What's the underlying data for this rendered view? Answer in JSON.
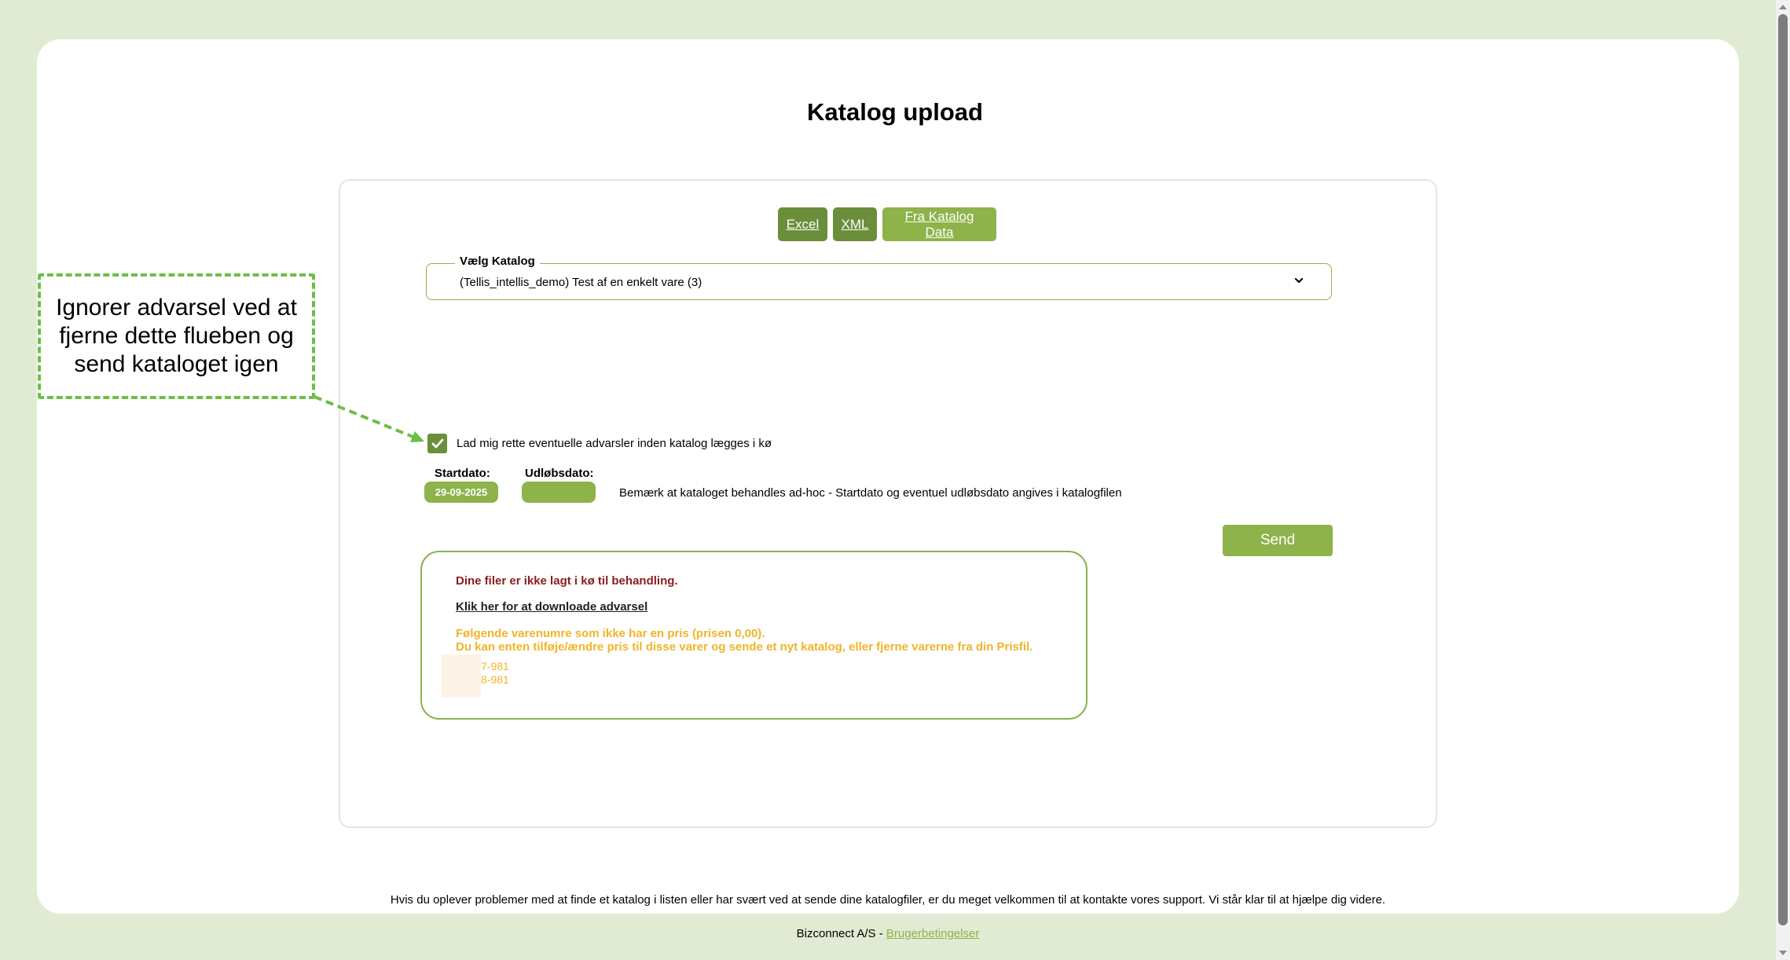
{
  "page": {
    "title": "Katalog upload"
  },
  "tabs": [
    {
      "label": "Excel"
    },
    {
      "label": "XML"
    },
    {
      "label": "Fra Katalog Data"
    }
  ],
  "catalog_select": {
    "legend": "Vælg Katalog",
    "value": "(Tellis_intellis_demo) Test af en enkelt vare (3)"
  },
  "callout": {
    "text": "Ignorer advarsel ved at fjerne dette flueben og send kataloget igen"
  },
  "checkbox": {
    "label": "Lad mig rette eventuelle advarsler inden katalog lægges i kø",
    "checked": true
  },
  "dates": {
    "start_label": "Startdato:",
    "start_value": "29-09-2025",
    "end_label": "Udløbsdato:",
    "end_value": "",
    "note": "Bemærk at kataloget behandles ad-hoc - Startdato og eventuel udløbsdato angives i katalogfilen"
  },
  "send_button": {
    "label": "Send"
  },
  "warning": {
    "title": "Dine filer er ikke lagt i kø til behandling.",
    "download_link": "Klik her for at downloade advarsel",
    "line1": "Følgende varenumre som ikke har en pris (prisen 0,00).",
    "line2": "Du kan enten tilføje/ændre pris til disse varer og sende et nyt katalog, eller fjerne varerne fra din Prisfil.",
    "codes": [
      "7-981",
      "8-981"
    ]
  },
  "support_text": "Hvis du oplever problemer med at finde et katalog i listen eller har svært ved at sende dine katalogfiler, er du meget velkommen til at kontakte vores support. Vi står klar til at hjælpe dig videre.",
  "footer": {
    "company": "Bizconnect A/S - ",
    "terms_link": "Brugerbetingelser"
  },
  "colors": {
    "page_bg": "#e1ebd3",
    "primary_green": "#8db34a",
    "dark_green": "#6b8e3a",
    "callout_border": "#6cbf45",
    "warning_red": "#8b1c1c",
    "warning_orange": "#f0b429"
  }
}
